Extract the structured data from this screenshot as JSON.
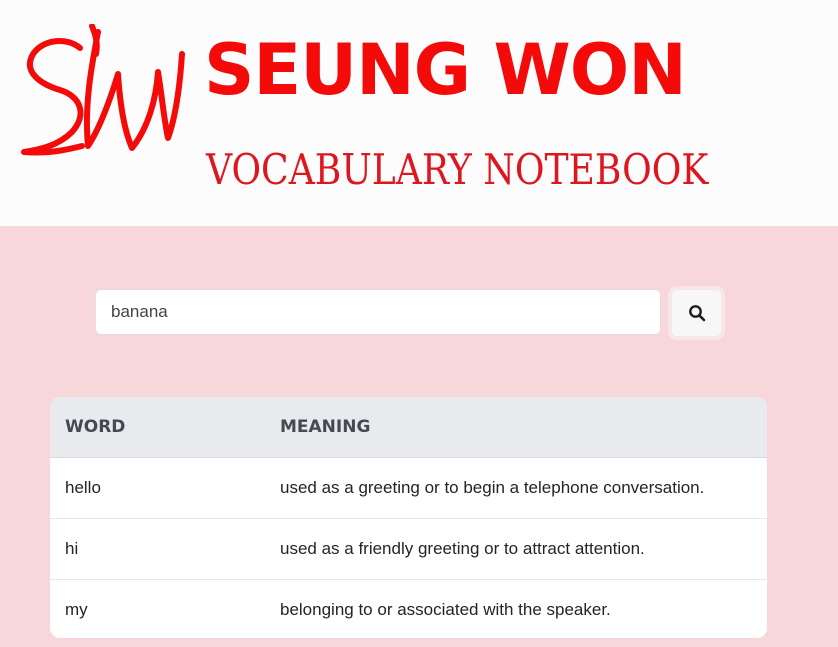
{
  "header": {
    "logo_text": "SW",
    "title": "SEUNG WON",
    "subtitle": "VOCABULARY NOTEBOOK"
  },
  "search": {
    "value": "banana",
    "button_icon": "search-icon"
  },
  "table": {
    "columns": [
      "WORD",
      "MEANING"
    ],
    "rows": [
      {
        "word": "hello",
        "meaning": "used as a greeting or to begin a telephone conversation."
      },
      {
        "word": "hi",
        "meaning": "used as a friendly greeting or to attract attention."
      },
      {
        "word": "my",
        "meaning": "belonging to or associated with the speaker."
      }
    ]
  },
  "colors": {
    "page_background": "#f8d7da",
    "header_background": "#fdfcfd",
    "brand_red": "#f50a0a",
    "subtitle_red": "#dd1720",
    "table_header_background": "#e8eaed"
  }
}
